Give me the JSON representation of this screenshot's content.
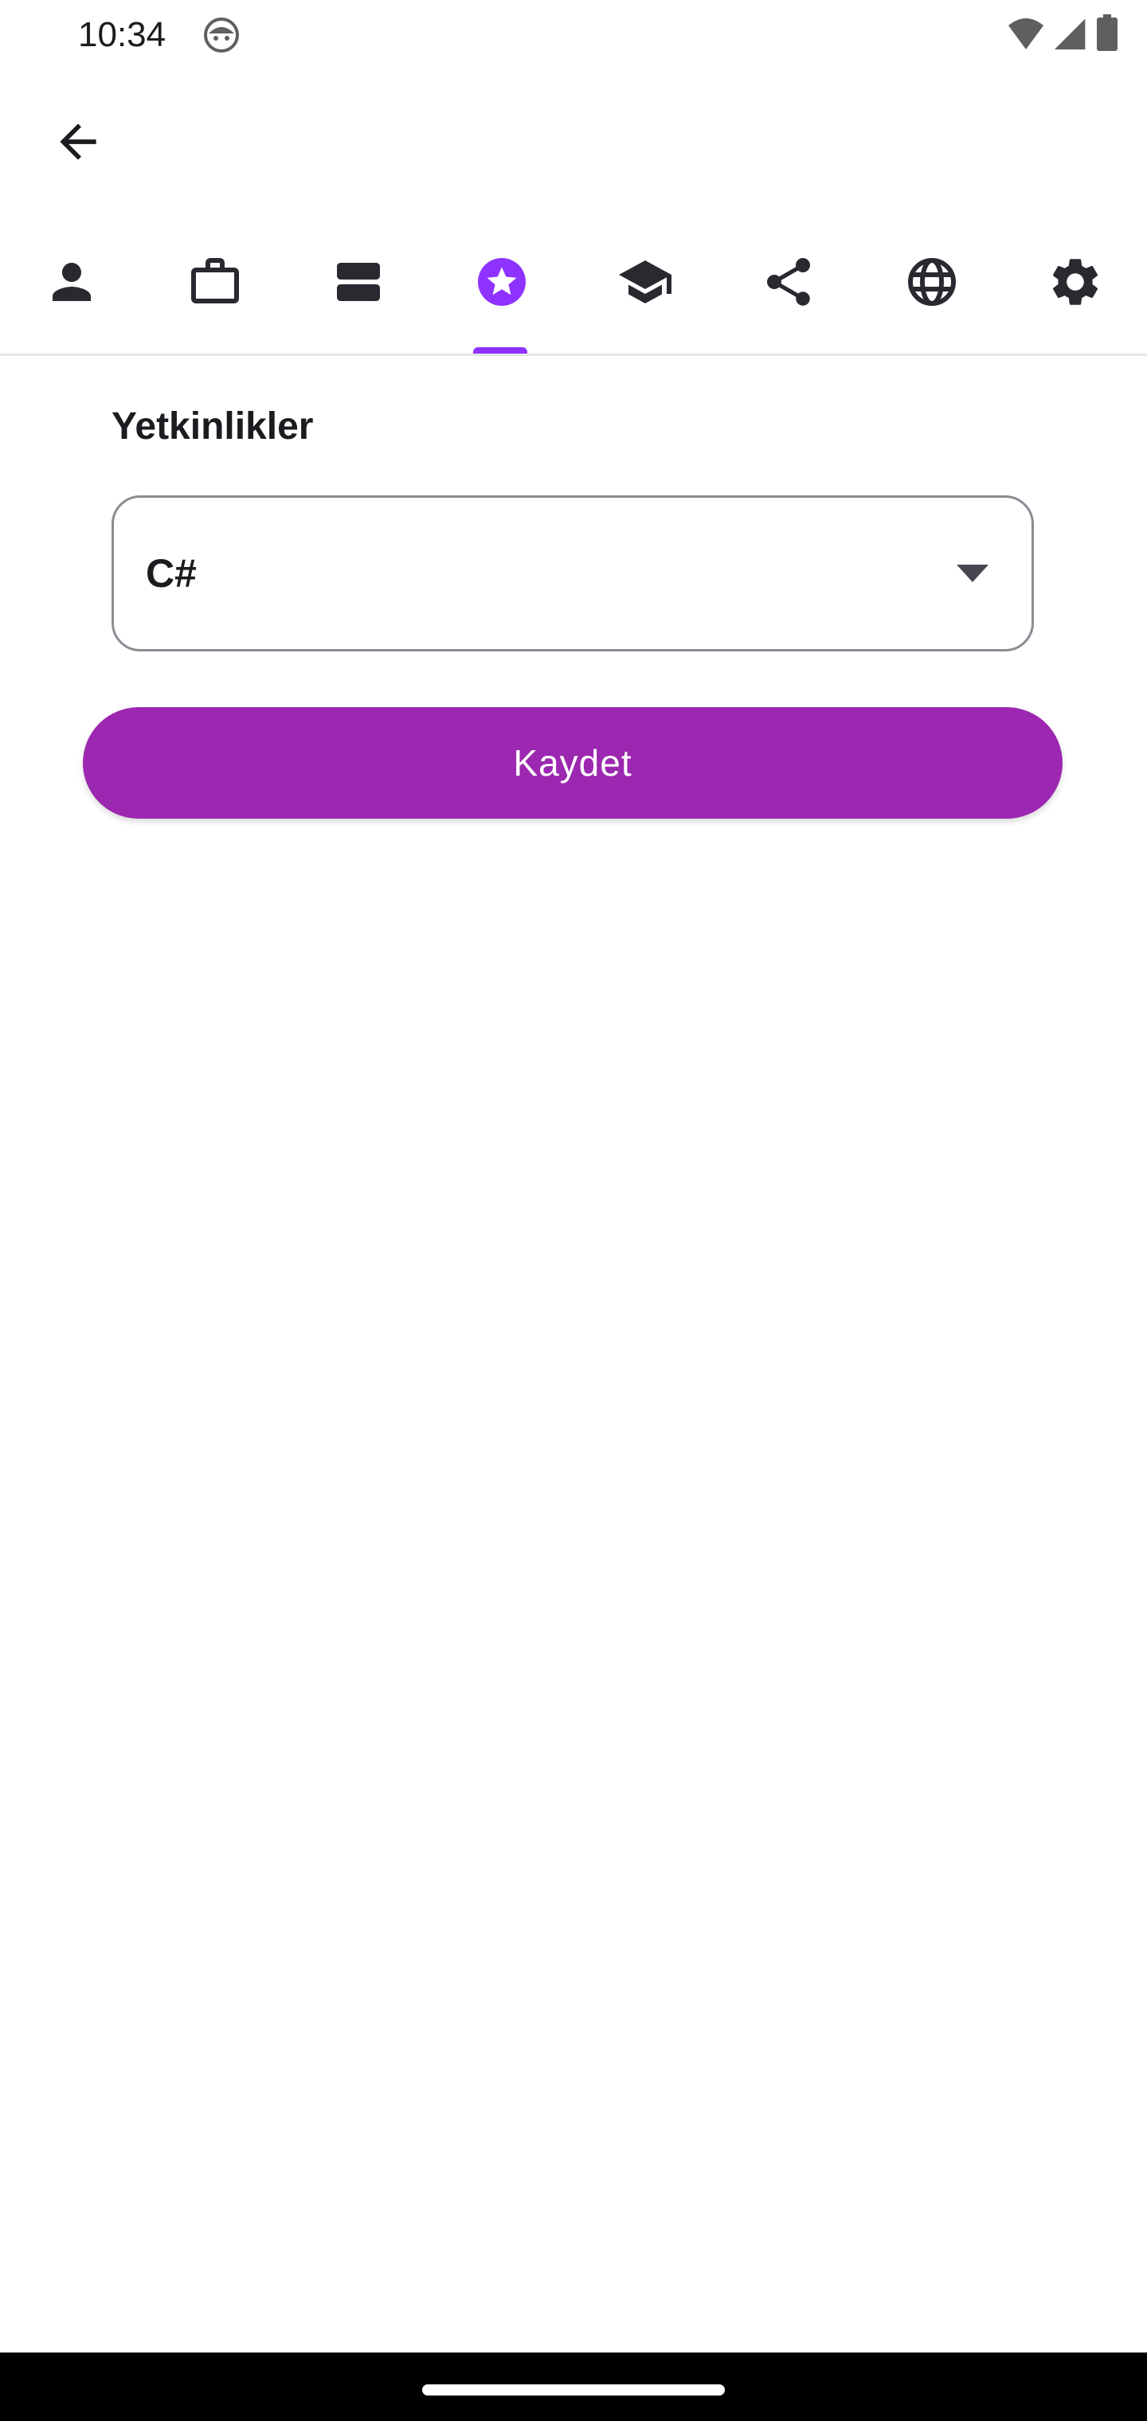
{
  "status_bar": {
    "time": "10:34",
    "icons": [
      "android-face-icon",
      "wifi-icon",
      "cellular-signal-icon",
      "battery-icon"
    ]
  },
  "app_bar": {
    "back_icon": "arrow-back-icon"
  },
  "tabs": [
    {
      "icon": "person-icon",
      "selected": false
    },
    {
      "icon": "briefcase-icon",
      "selected": false
    },
    {
      "icon": "view-agenda-icon",
      "selected": false
    },
    {
      "icon": "star-circle-icon",
      "selected": true
    },
    {
      "icon": "school-icon",
      "selected": false
    },
    {
      "icon": "share-icon",
      "selected": false
    },
    {
      "icon": "globe-icon",
      "selected": false
    },
    {
      "icon": "settings-gear-icon",
      "selected": false
    }
  ],
  "main": {
    "section_title": "Yetkinlikler",
    "skill_select": {
      "selected_value": "C#",
      "arrow_icon": "dropdown-arrow-icon"
    },
    "save_button_label": "Kaydet"
  },
  "colors": {
    "accent": "#8e33ff",
    "button": "#9c27b0",
    "icon": "#2b2930"
  }
}
